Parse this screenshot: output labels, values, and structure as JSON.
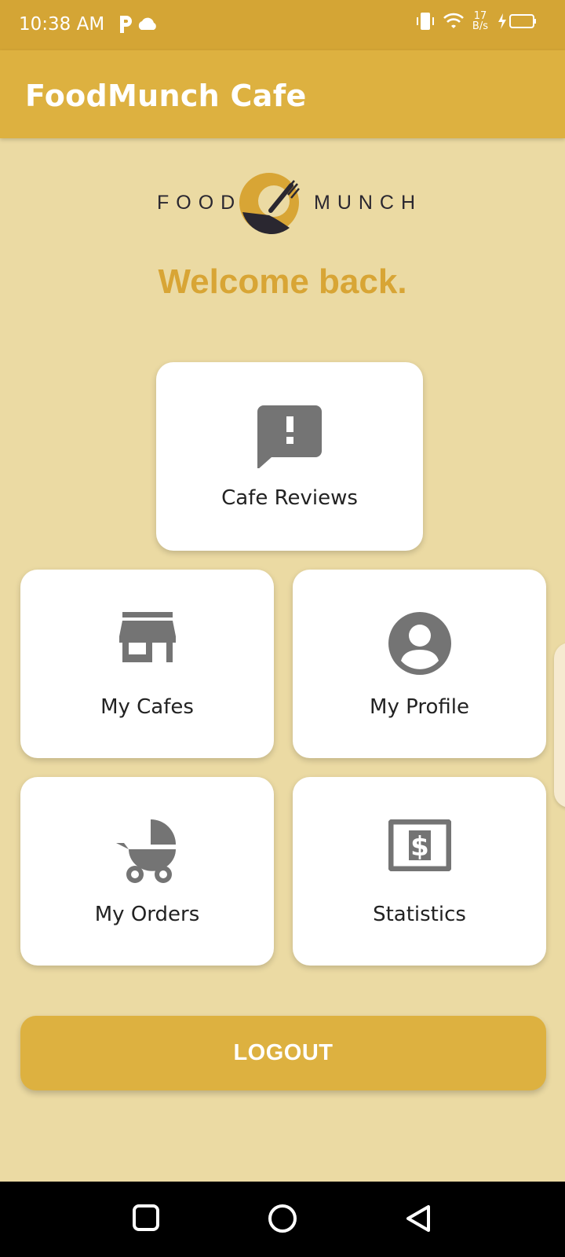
{
  "status_bar": {
    "time": "10:38 AM",
    "net_speed_value": "17",
    "net_speed_unit": "B/s",
    "icons": [
      "parking-icon",
      "cloud-icon",
      "vibrate-icon",
      "wifi-icon",
      "battery-charging-icon"
    ]
  },
  "app_bar": {
    "title": "FoodMunch Cafe"
  },
  "logo": {
    "left_word": "FOOD",
    "right_word": "MUNCH"
  },
  "welcome": "Welcome back.",
  "menu": {
    "reviews": {
      "label": "Cafe Reviews",
      "icon": "feedback-icon"
    },
    "cafes": {
      "label": "My Cafes",
      "icon": "store-icon"
    },
    "profile": {
      "label": "My Profile",
      "icon": "account-circle-icon"
    },
    "orders": {
      "label": "My Orders",
      "icon": "stroller-icon"
    },
    "stats": {
      "label": "Statistics",
      "icon": "money-icon"
    }
  },
  "logout_label": "LOGOUT",
  "nav_bar": {
    "icons": [
      "recents-icon",
      "home-icon",
      "back-icon"
    ]
  },
  "colors": {
    "status_bar": "#d4a535",
    "app_bar": "#ddb140",
    "background": "#ebdaa3",
    "accent_text": "#d8a535",
    "icon_gray": "#747474"
  }
}
